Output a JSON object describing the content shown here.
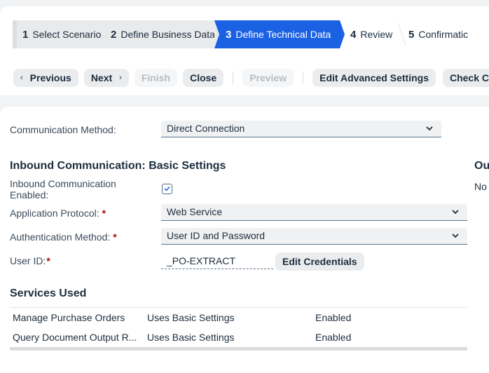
{
  "wizard": {
    "steps": [
      {
        "number": "1",
        "label": "Select Scenario",
        "state": "done"
      },
      {
        "number": "2",
        "label": "Define Business Data",
        "state": "done"
      },
      {
        "number": "3",
        "label": "Define Technical Data",
        "state": "active"
      },
      {
        "number": "4",
        "label": "Review",
        "state": "upcoming"
      },
      {
        "number": "5",
        "label": "Confirmatic",
        "state": "upcoming"
      }
    ],
    "active_color": "#1b61e4"
  },
  "toolbar": {
    "previous": "Previous",
    "next": "Next",
    "finish": "Finish",
    "close": "Close",
    "preview": "Preview",
    "edit_advanced": "Edit Advanced Settings",
    "check_completeness": "Check Completen"
  },
  "form": {
    "communication_method": {
      "label": "Communication Method:",
      "value": "Direct Connection"
    },
    "inbound_title": "Inbound Communication: Basic Settings",
    "outbound_title": "Ou",
    "outbound_value": "No",
    "inbound_enabled": {
      "label_line1": "Inbound Communication",
      "label_line2": "Enabled:",
      "checked": true
    },
    "application_protocol": {
      "label": "Application Protocol:",
      "required": "*",
      "value": "Web Service"
    },
    "authentication_method": {
      "label": "Authentication Method:",
      "required": "*",
      "value": "User ID and Password"
    },
    "user_id": {
      "label": "User ID:",
      "required": "*",
      "value": "_PO-EXTRACT",
      "edit_button": "Edit Credentials"
    }
  },
  "services": {
    "title": "Services Used",
    "rows": [
      {
        "name": "Manage Purchase Orders",
        "settings": "Uses Basic Settings",
        "status": "Enabled"
      },
      {
        "name": "Query Document Output R...",
        "settings": "Uses Basic Settings",
        "status": "Enabled"
      }
    ]
  }
}
